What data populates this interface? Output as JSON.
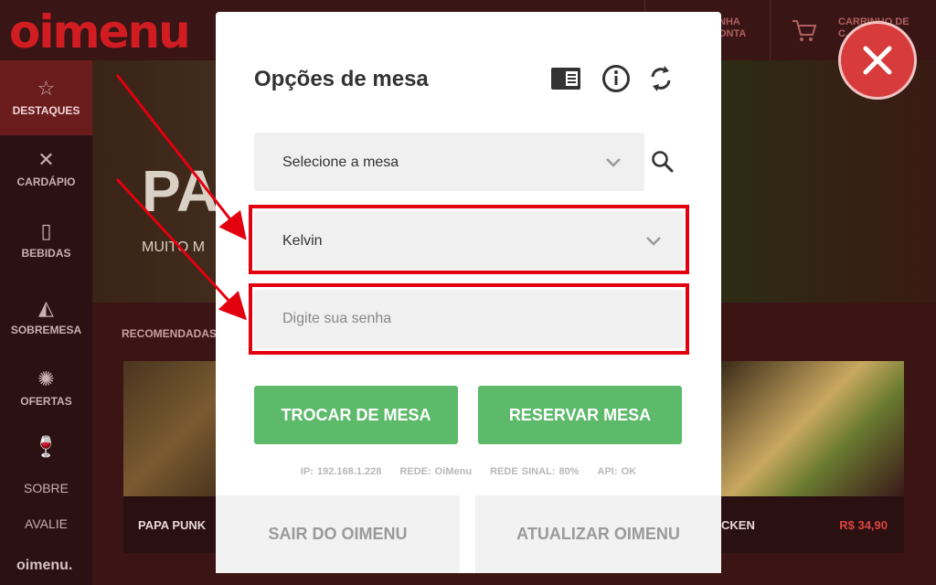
{
  "app": {
    "logo_text": "oimenu",
    "topnav": [
      {
        "label": "NHA\nONTA"
      },
      {
        "label": "CARRINHO DE\nC..."
      }
    ],
    "hero": {
      "title": "PA",
      "subtitle": "MUITO M"
    },
    "recommended_label": "RECOMENDADAS",
    "footer_logo": "oimenu."
  },
  "sidebar": {
    "items": [
      {
        "label": "DESTAQUES",
        "icon": "star-icon"
      },
      {
        "label": "CARDÁPIO",
        "icon": "cutlery-icon"
      },
      {
        "label": "BEBIDAS",
        "icon": "beer-icon"
      },
      {
        "label": "SOBREMESA",
        "icon": "cake-icon"
      },
      {
        "label": "OFERTAS",
        "icon": "discount-icon"
      },
      {
        "label": "",
        "icon": "wine-glass-icon"
      }
    ],
    "links": [
      "SOBRE",
      "AVALIE"
    ]
  },
  "cards": [
    {
      "name": "PAPA PUNK",
      "price": ""
    },
    {
      "name": "CKEN",
      "price": "R$ 34,90"
    }
  ],
  "modal": {
    "title": "Opções de mesa",
    "icons": [
      "menu-card-icon",
      "info-icon",
      "refresh-icon"
    ],
    "table_select": {
      "value": "Selecione a mesa"
    },
    "waiter_select": {
      "value": "Kelvin"
    },
    "password": {
      "placeholder": "Digite sua senha",
      "value": ""
    },
    "buttons": {
      "change_table": "TROCAR DE MESA",
      "reserve_table": "RESERVAR MESA",
      "exit": "SAIR DO OIMENU",
      "update": "ATUALIZAR OIMENU"
    },
    "status": {
      "ip": "IP: 192.168.1.228",
      "network": "REDE: OiMenu",
      "signal": "REDE SINAL: 80%",
      "api": "API: OK"
    }
  },
  "colors": {
    "accent_red": "#d11c22",
    "button_green": "#5cba6a",
    "highlight_red": "#e3000f",
    "close_red": "#d83b3b"
  }
}
